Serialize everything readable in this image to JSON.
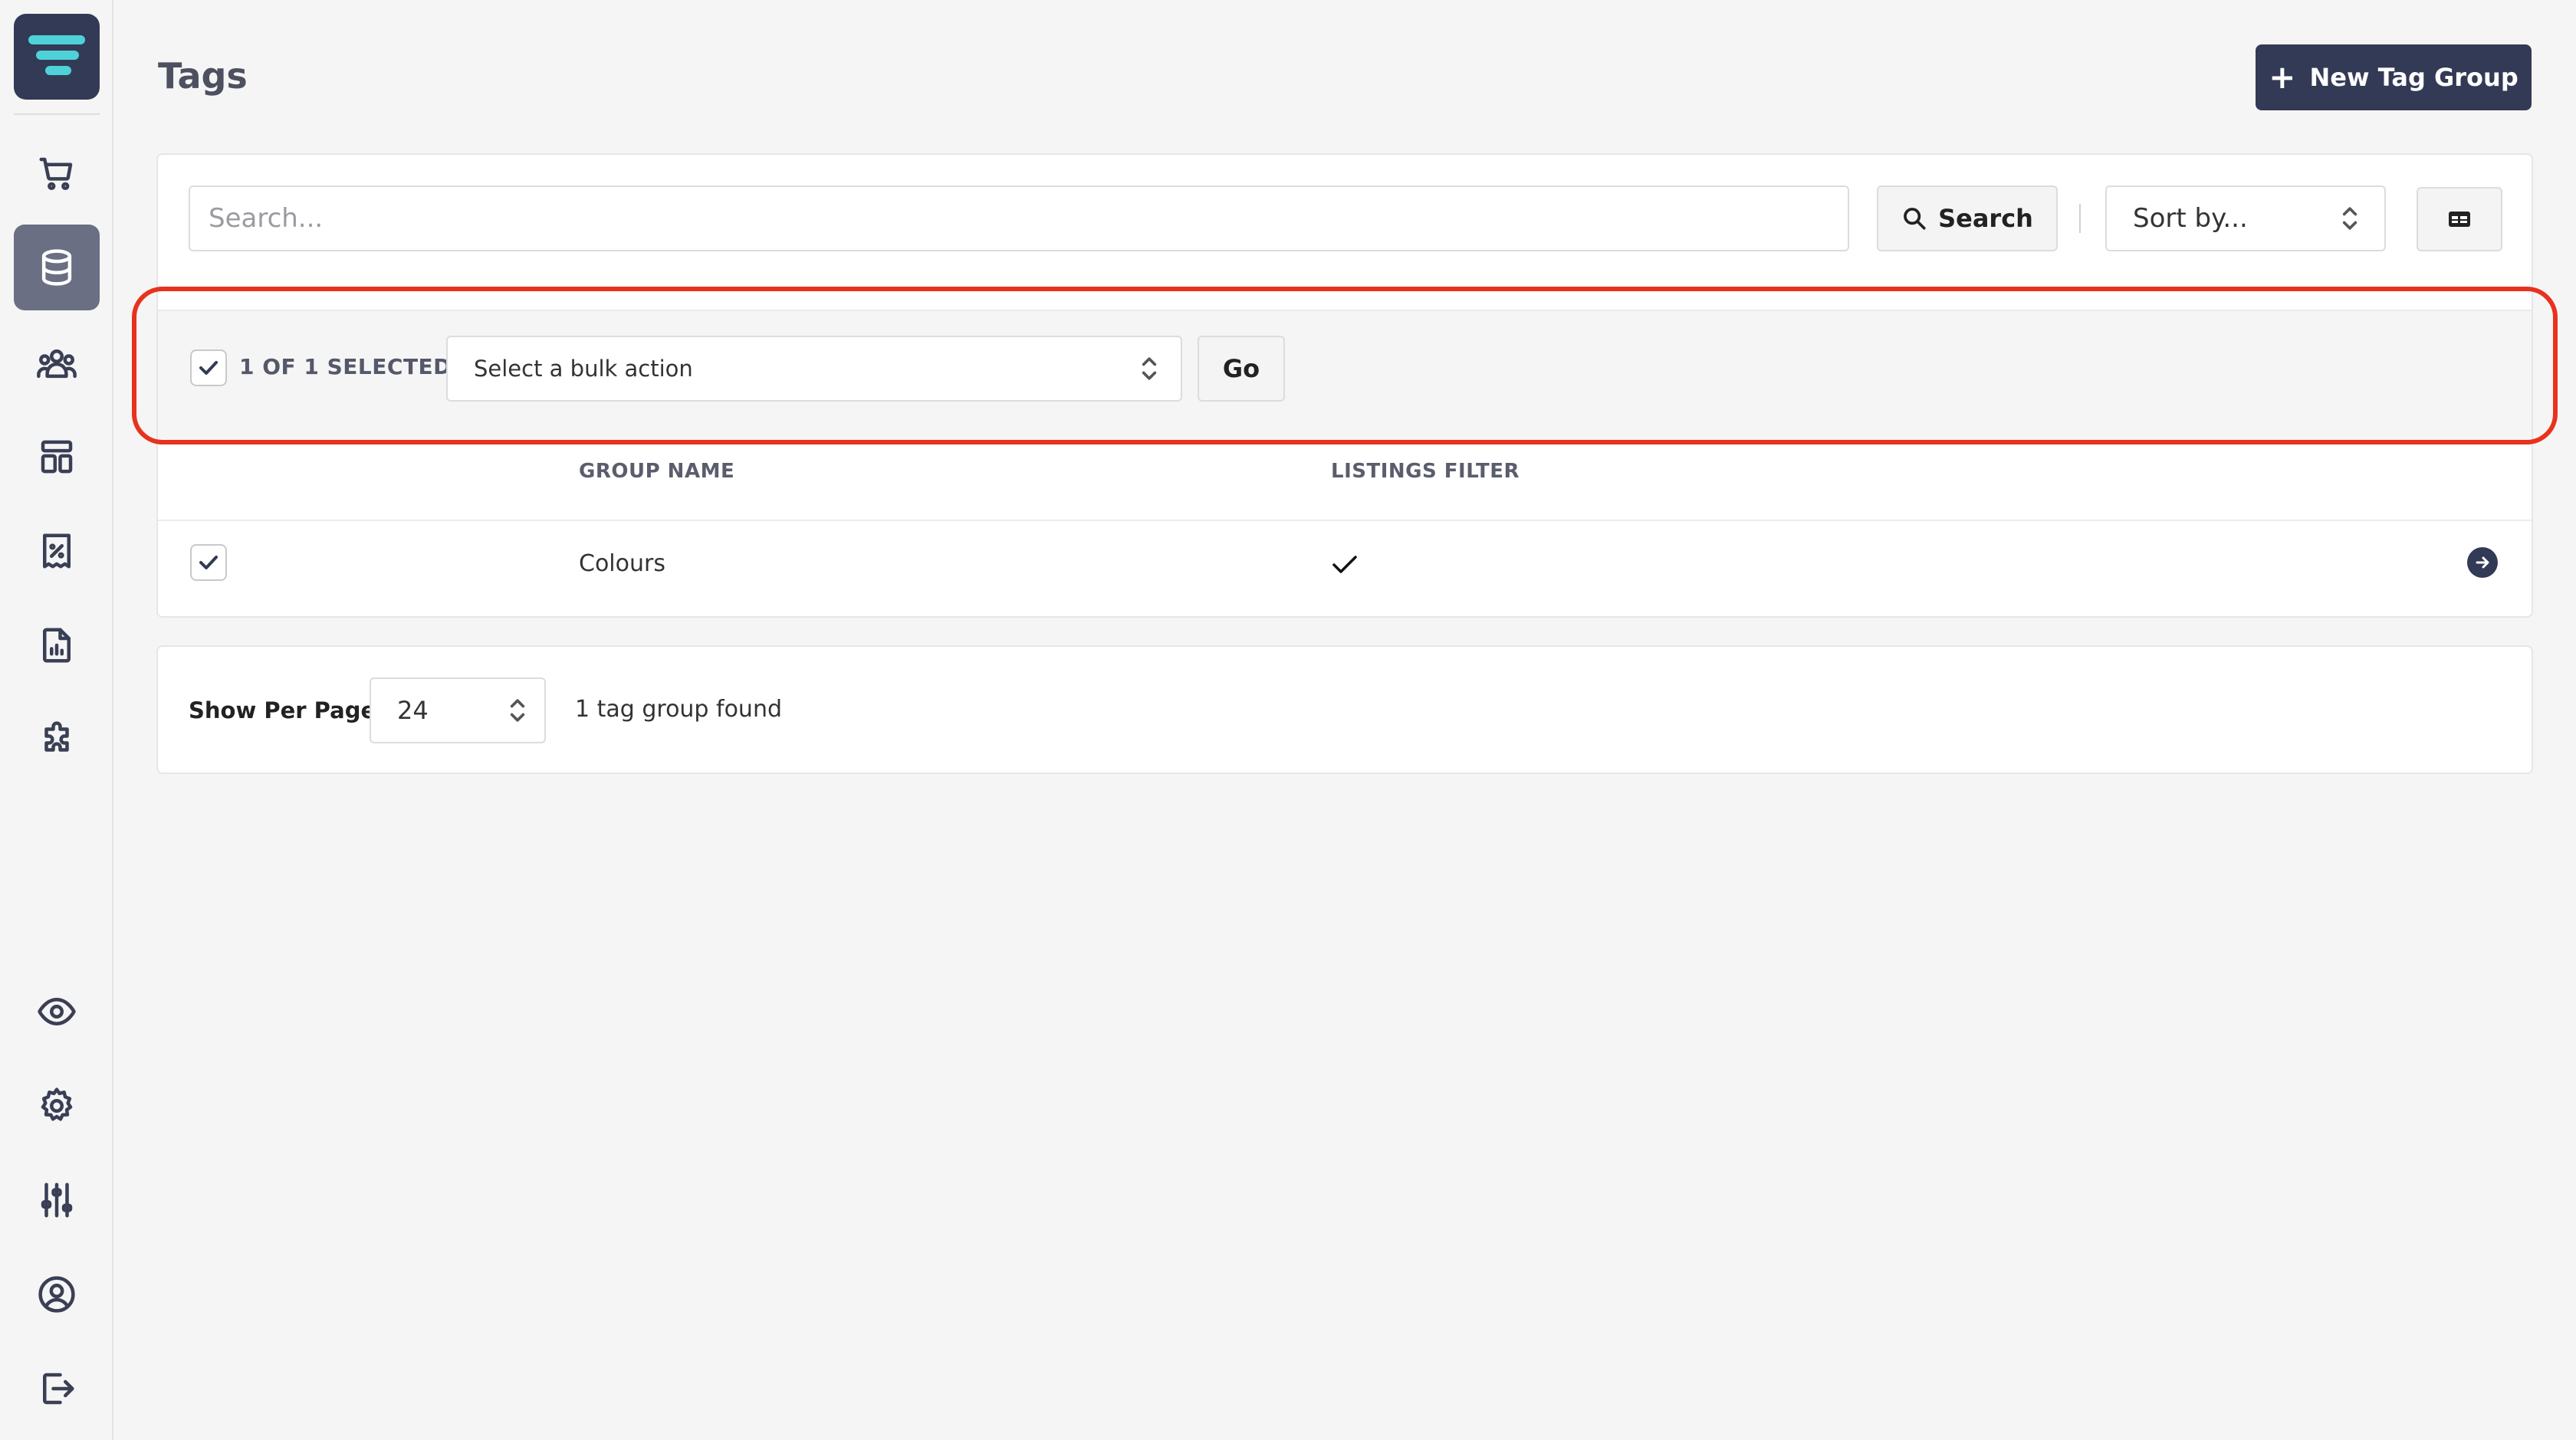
{
  "page": {
    "title": "Tags"
  },
  "header": {
    "new_button_label": "New Tag Group"
  },
  "sidebar": {
    "items": [
      {
        "name": "orders",
        "icon": "cart-icon",
        "active": false
      },
      {
        "name": "catalog",
        "icon": "database-icon",
        "active": true
      },
      {
        "name": "customers",
        "icon": "users-icon",
        "active": false
      },
      {
        "name": "content",
        "icon": "layout-icon",
        "active": false
      },
      {
        "name": "discounts",
        "icon": "receipt-percent-icon",
        "active": false
      },
      {
        "name": "reports",
        "icon": "report-chart-icon",
        "active": false
      },
      {
        "name": "extensions",
        "icon": "puzzle-icon",
        "active": false
      }
    ],
    "bottom_items": [
      {
        "name": "preview",
        "icon": "eye-icon"
      },
      {
        "name": "settings",
        "icon": "gear-icon"
      },
      {
        "name": "preferences",
        "icon": "sliders-icon"
      },
      {
        "name": "account",
        "icon": "user-circle-icon"
      },
      {
        "name": "logout",
        "icon": "logout-icon"
      }
    ]
  },
  "search": {
    "placeholder": "Search...",
    "button_label": "Search",
    "sort_placeholder": "Sort by..."
  },
  "bulk": {
    "selected_text": "1 OF 1 SELECTED",
    "action_placeholder": "Select a bulk action",
    "go_label": "Go"
  },
  "table": {
    "columns": [
      "GROUP NAME",
      "LISTINGS FILTER"
    ],
    "rows": [
      {
        "checked": true,
        "group_name": "Colours",
        "listings_filter": true
      }
    ]
  },
  "footer": {
    "per_page_label": "Show Per Page",
    "per_page_value": "24",
    "found_text": "1 tag group found"
  },
  "colors": {
    "brand": "#333a55",
    "highlight": "#e8321e",
    "logo_accent": "#4fd1d9"
  }
}
